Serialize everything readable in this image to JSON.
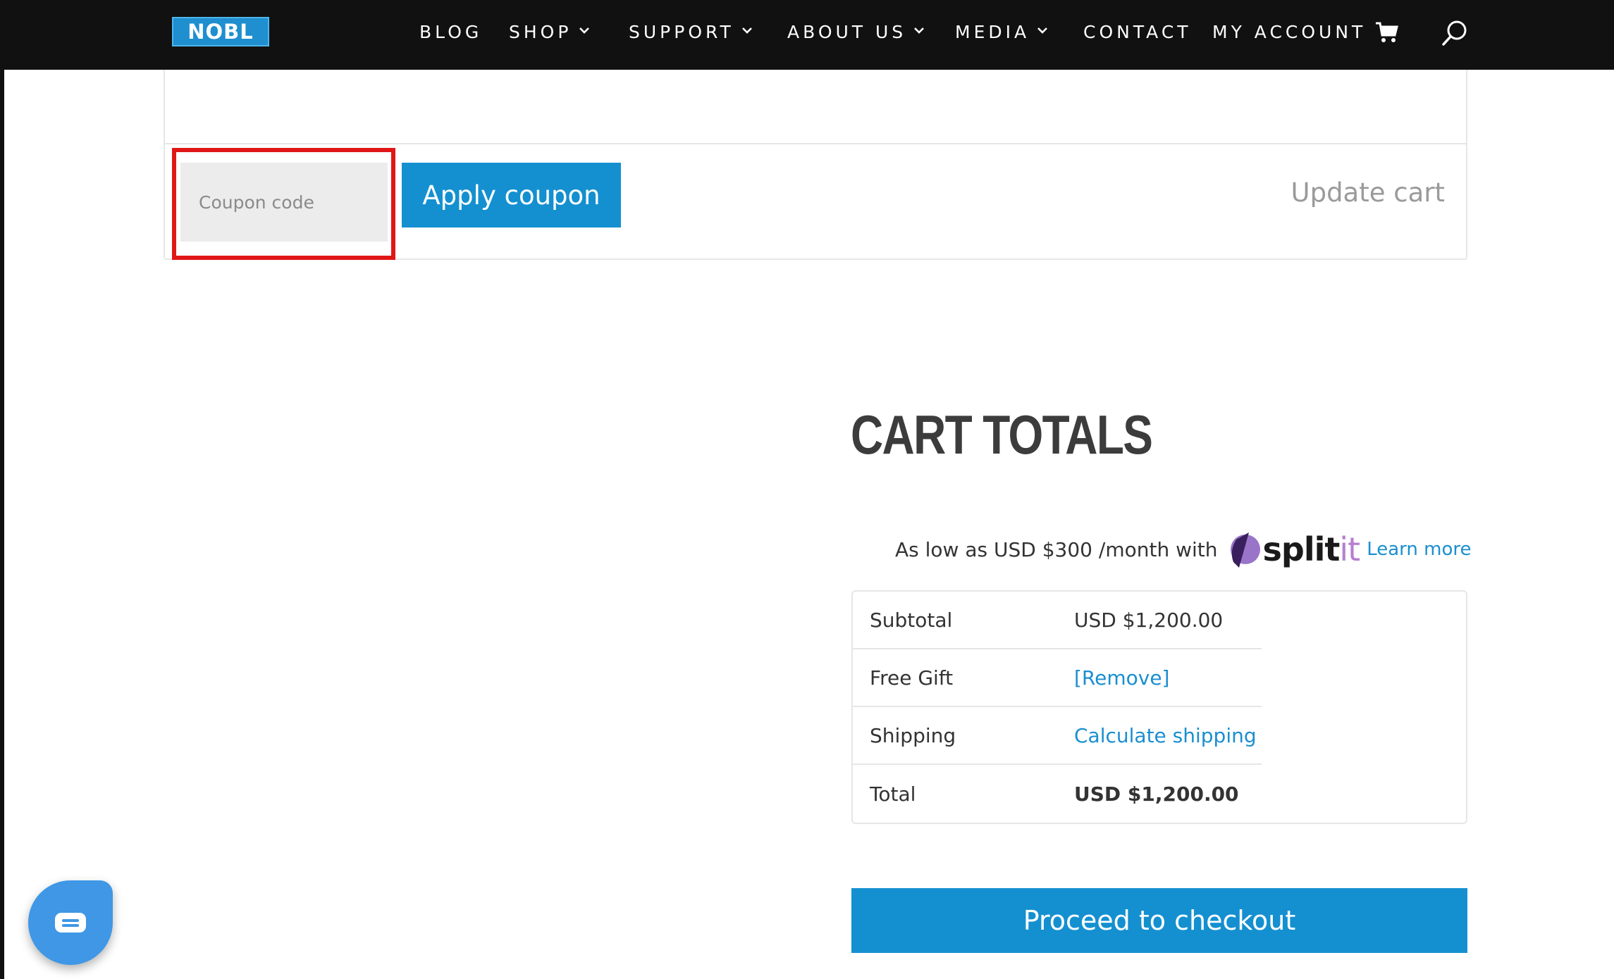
{
  "brand": {
    "logo_text": "NOBL"
  },
  "nav": {
    "items": [
      {
        "label": "BLOG",
        "has_dropdown": false
      },
      {
        "label": "SHOP",
        "has_dropdown": true
      },
      {
        "label": "SUPPORT",
        "has_dropdown": true
      },
      {
        "label": "ABOUT US",
        "has_dropdown": true
      },
      {
        "label": "MEDIA",
        "has_dropdown": true
      },
      {
        "label": "CONTACT",
        "has_dropdown": false
      },
      {
        "label": "MY ACCOUNT",
        "has_dropdown": false
      }
    ],
    "icons": [
      "cart-icon",
      "search-icon"
    ]
  },
  "cart_actions": {
    "coupon_placeholder": "Coupon code",
    "coupon_value": "",
    "apply_label": "Apply coupon",
    "update_label": "Update cart"
  },
  "totals": {
    "title": "CART TOTALS",
    "financing_text": "As low as USD $300 /month with",
    "financing_brand_main": "split",
    "financing_brand_suffix": "it",
    "learn_more": "Learn more",
    "rows": [
      {
        "label": "Subtotal",
        "value": "USD $1,200.00"
      },
      {
        "label": "Free Gift",
        "value": "[Remove]"
      },
      {
        "label": "Shipping",
        "value": "Calculate shipping"
      },
      {
        "label": "Total",
        "value": "USD $1,200.00"
      }
    ],
    "checkout_label": "Proceed to checkout"
  },
  "colors": {
    "nav_bg": "#111111",
    "accent_blue": "#1490d0",
    "link_blue": "#1a8fd0",
    "highlight_red": "#e01717",
    "splitit_purple": "#b77fd0"
  }
}
